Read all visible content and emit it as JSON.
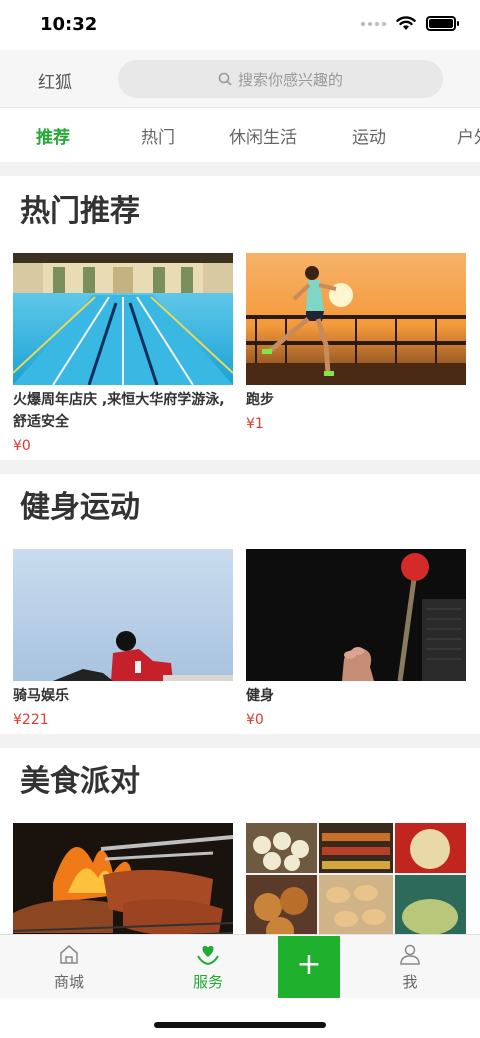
{
  "status_bar": {
    "time": "10:32"
  },
  "header": {
    "city": "红狐",
    "search_placeholder": "搜索你感兴趣的"
  },
  "tabs": [
    {
      "label": "推荐",
      "active": true
    },
    {
      "label": "热门",
      "active": false
    },
    {
      "label": "休闲生活",
      "active": false
    },
    {
      "label": "运动",
      "active": false
    },
    {
      "label": "户外",
      "active": false
    }
  ],
  "sections": [
    {
      "title": "热门推荐",
      "items": [
        {
          "title": "火爆周年店庆 ,来恒大华府学游泳,舒适安全",
          "price": "¥0",
          "image": "swimming-pool"
        },
        {
          "title": "跑步",
          "price": "¥1",
          "image": "runner-sunset"
        }
      ]
    },
    {
      "title": "健身运动",
      "items": [
        {
          "title": "骑马娱乐",
          "price": "¥221",
          "image": "horse-rider"
        },
        {
          "title": "健身",
          "price": "¥0",
          "image": "gym-equipment"
        }
      ]
    },
    {
      "title": "美食派对",
      "items": [
        {
          "title": "",
          "price": "",
          "image": "bbq-grill"
        },
        {
          "title": "",
          "price": "",
          "image": "food-collage"
        }
      ]
    }
  ],
  "tabbar": {
    "items": [
      {
        "label": "商城",
        "icon": "home-icon",
        "active": false
      },
      {
        "label": "服务",
        "icon": "heart-hand-icon",
        "active": true
      },
      {
        "label": "+",
        "icon": "plus-icon",
        "active": false
      },
      {
        "label": "我",
        "icon": "user-icon",
        "active": false
      }
    ]
  },
  "colors": {
    "accent": "#22aa33",
    "price": "#e03a2e"
  }
}
